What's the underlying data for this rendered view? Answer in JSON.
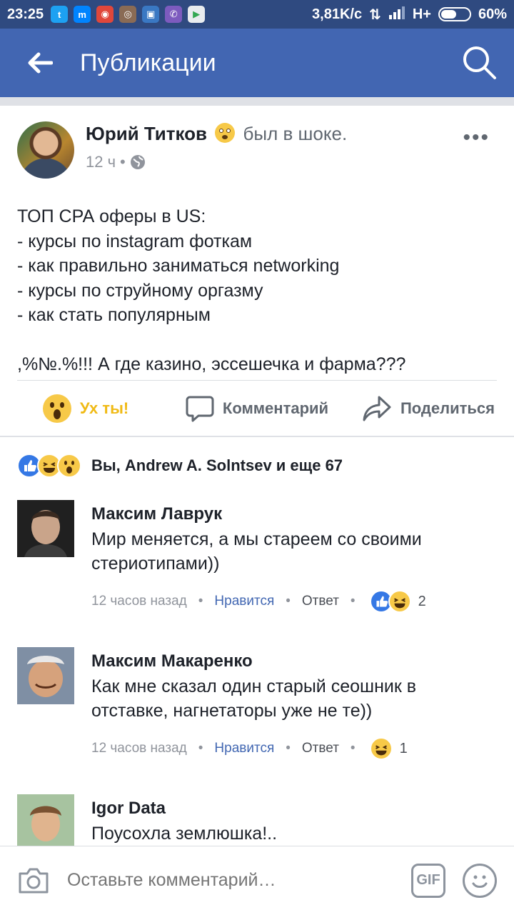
{
  "status_bar": {
    "time": "23:25",
    "network_speed": "3,81K/c",
    "network_type": "H+",
    "battery": "60%",
    "battery_level": 0.6,
    "app_icons": [
      "twitter-icon",
      "messenger-icon",
      "chrome-icon",
      "instagram-icon",
      "app-icon",
      "viber-icon",
      "play-store-icon"
    ]
  },
  "header": {
    "title": "Публикации"
  },
  "post": {
    "author": "Юрий Титков",
    "feeling": "был в шоке.",
    "time": "12 ч",
    "separator": "•",
    "text": "ТОП СРА оферы в US:\n- курсы по instagram фоткам\n- как правильно заниматься networking\n- курсы по струйному оргазму\n- как стать популярным\n\n,%№.%!!! А где казино, эссешечка и фарма???",
    "more": "•••"
  },
  "actions": {
    "reaction_label": "Ух ты!",
    "comment_label": "Комментарий",
    "share_label": "Поделиться"
  },
  "reactions": {
    "summary": "Вы, Andrew A. Solntsev и еще 67"
  },
  "comments": [
    {
      "name": "Максим Лаврук",
      "text": "Мир меняется, а мы стареем со своими стериотипами))",
      "time": "12 часов назад",
      "like": "Нравится",
      "reply": "Ответ",
      "dot": "•",
      "reaction_count": "2"
    },
    {
      "name": "Максим Макаренко",
      "text": "Как мне сказал один старый сеошник в отставке, нагнетаторы уже не те))",
      "time": "12 часов назад",
      "like": "Нравится",
      "reply": "Ответ",
      "dot": "•",
      "reaction_count": "1"
    },
    {
      "name": "Igor Data",
      "text": "Поусохла землюшка!.."
    }
  ],
  "composer": {
    "placeholder": "Оставьте комментарий…",
    "gif_label": "GIF"
  },
  "colors": {
    "status_bar": "#2f4a80",
    "app_bar": "#4266b2",
    "link": "#4267b2",
    "wow": "#f0ba15",
    "like": "#3578e5"
  }
}
